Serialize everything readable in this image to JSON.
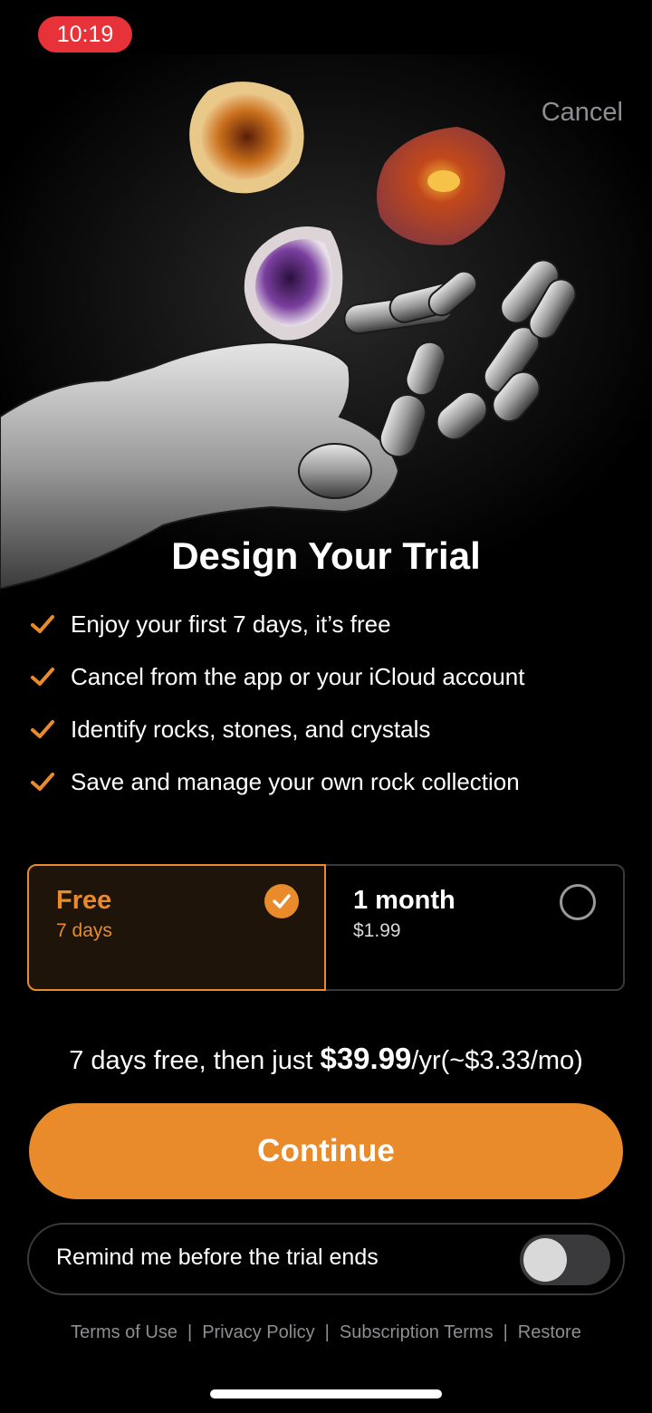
{
  "status": {
    "time": "10:19"
  },
  "header": {
    "cancel_label": "Cancel"
  },
  "title": "Design Your Trial",
  "features": [
    "Enjoy your first 7 days, it’s free",
    "Cancel from the app or your iCloud account",
    "Identify rocks, stones, and crystals",
    "Save and manage your own rock collection"
  ],
  "plans": [
    {
      "name": "Free",
      "detail": "7 days",
      "selected": true
    },
    {
      "name": "1 month",
      "detail": "$1.99",
      "selected": false
    }
  ],
  "pricing": {
    "prefix": "7 days free, then just ",
    "price": "$39.99",
    "suffix": "/yr(~$3.33/mo)"
  },
  "continue_label": "Continue",
  "reminder": {
    "label": "Remind me before the trial ends",
    "enabled": false
  },
  "footer": {
    "terms": "Terms of Use",
    "privacy": "Privacy Policy",
    "subscription": "Subscription Terms",
    "restore": "Restore"
  },
  "colors": {
    "accent": "#e98b2a",
    "background": "#000000",
    "status_pill": "#e8323a"
  },
  "icons": {
    "feature": "checkmark-icon",
    "hero": "robot-hand-with-crystals-illustration"
  }
}
